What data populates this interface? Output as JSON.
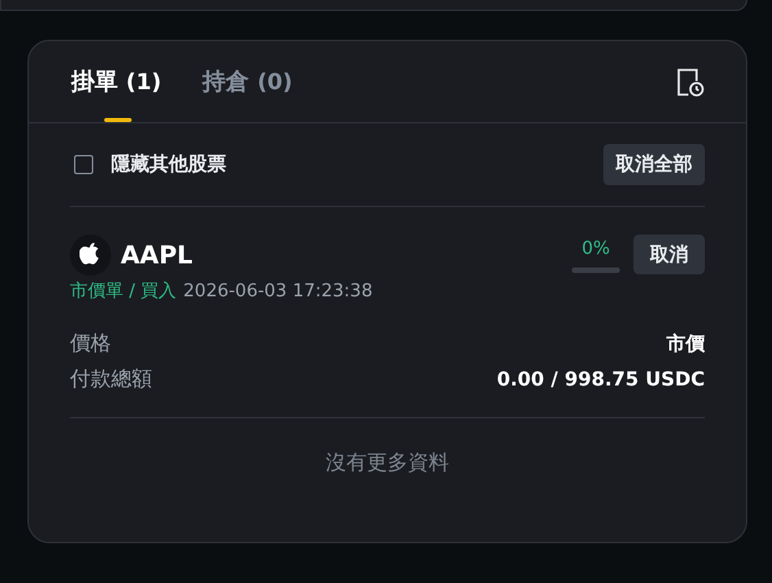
{
  "tabs": [
    {
      "label": "掛單",
      "count": "(1)",
      "selected": true
    },
    {
      "label": "持倉",
      "count": "(0)",
      "selected": false
    }
  ],
  "filter": {
    "label": "隱藏其他股票",
    "checked": false
  },
  "cancel_all_button": "取消全部",
  "orders": [
    {
      "symbol": "AAPL",
      "order_type": "市價單 / 買入",
      "time": "2026-06-03 17:23:38",
      "progress_text": "0%",
      "level": 0,
      "cancel_button": "取消",
      "details": [
        {
          "label": "價格",
          "value": "市價"
        },
        {
          "label": "付款總額",
          "value": "0.00 / 998.75 USDC"
        }
      ]
    }
  ],
  "footer": "沒有更多資料"
}
